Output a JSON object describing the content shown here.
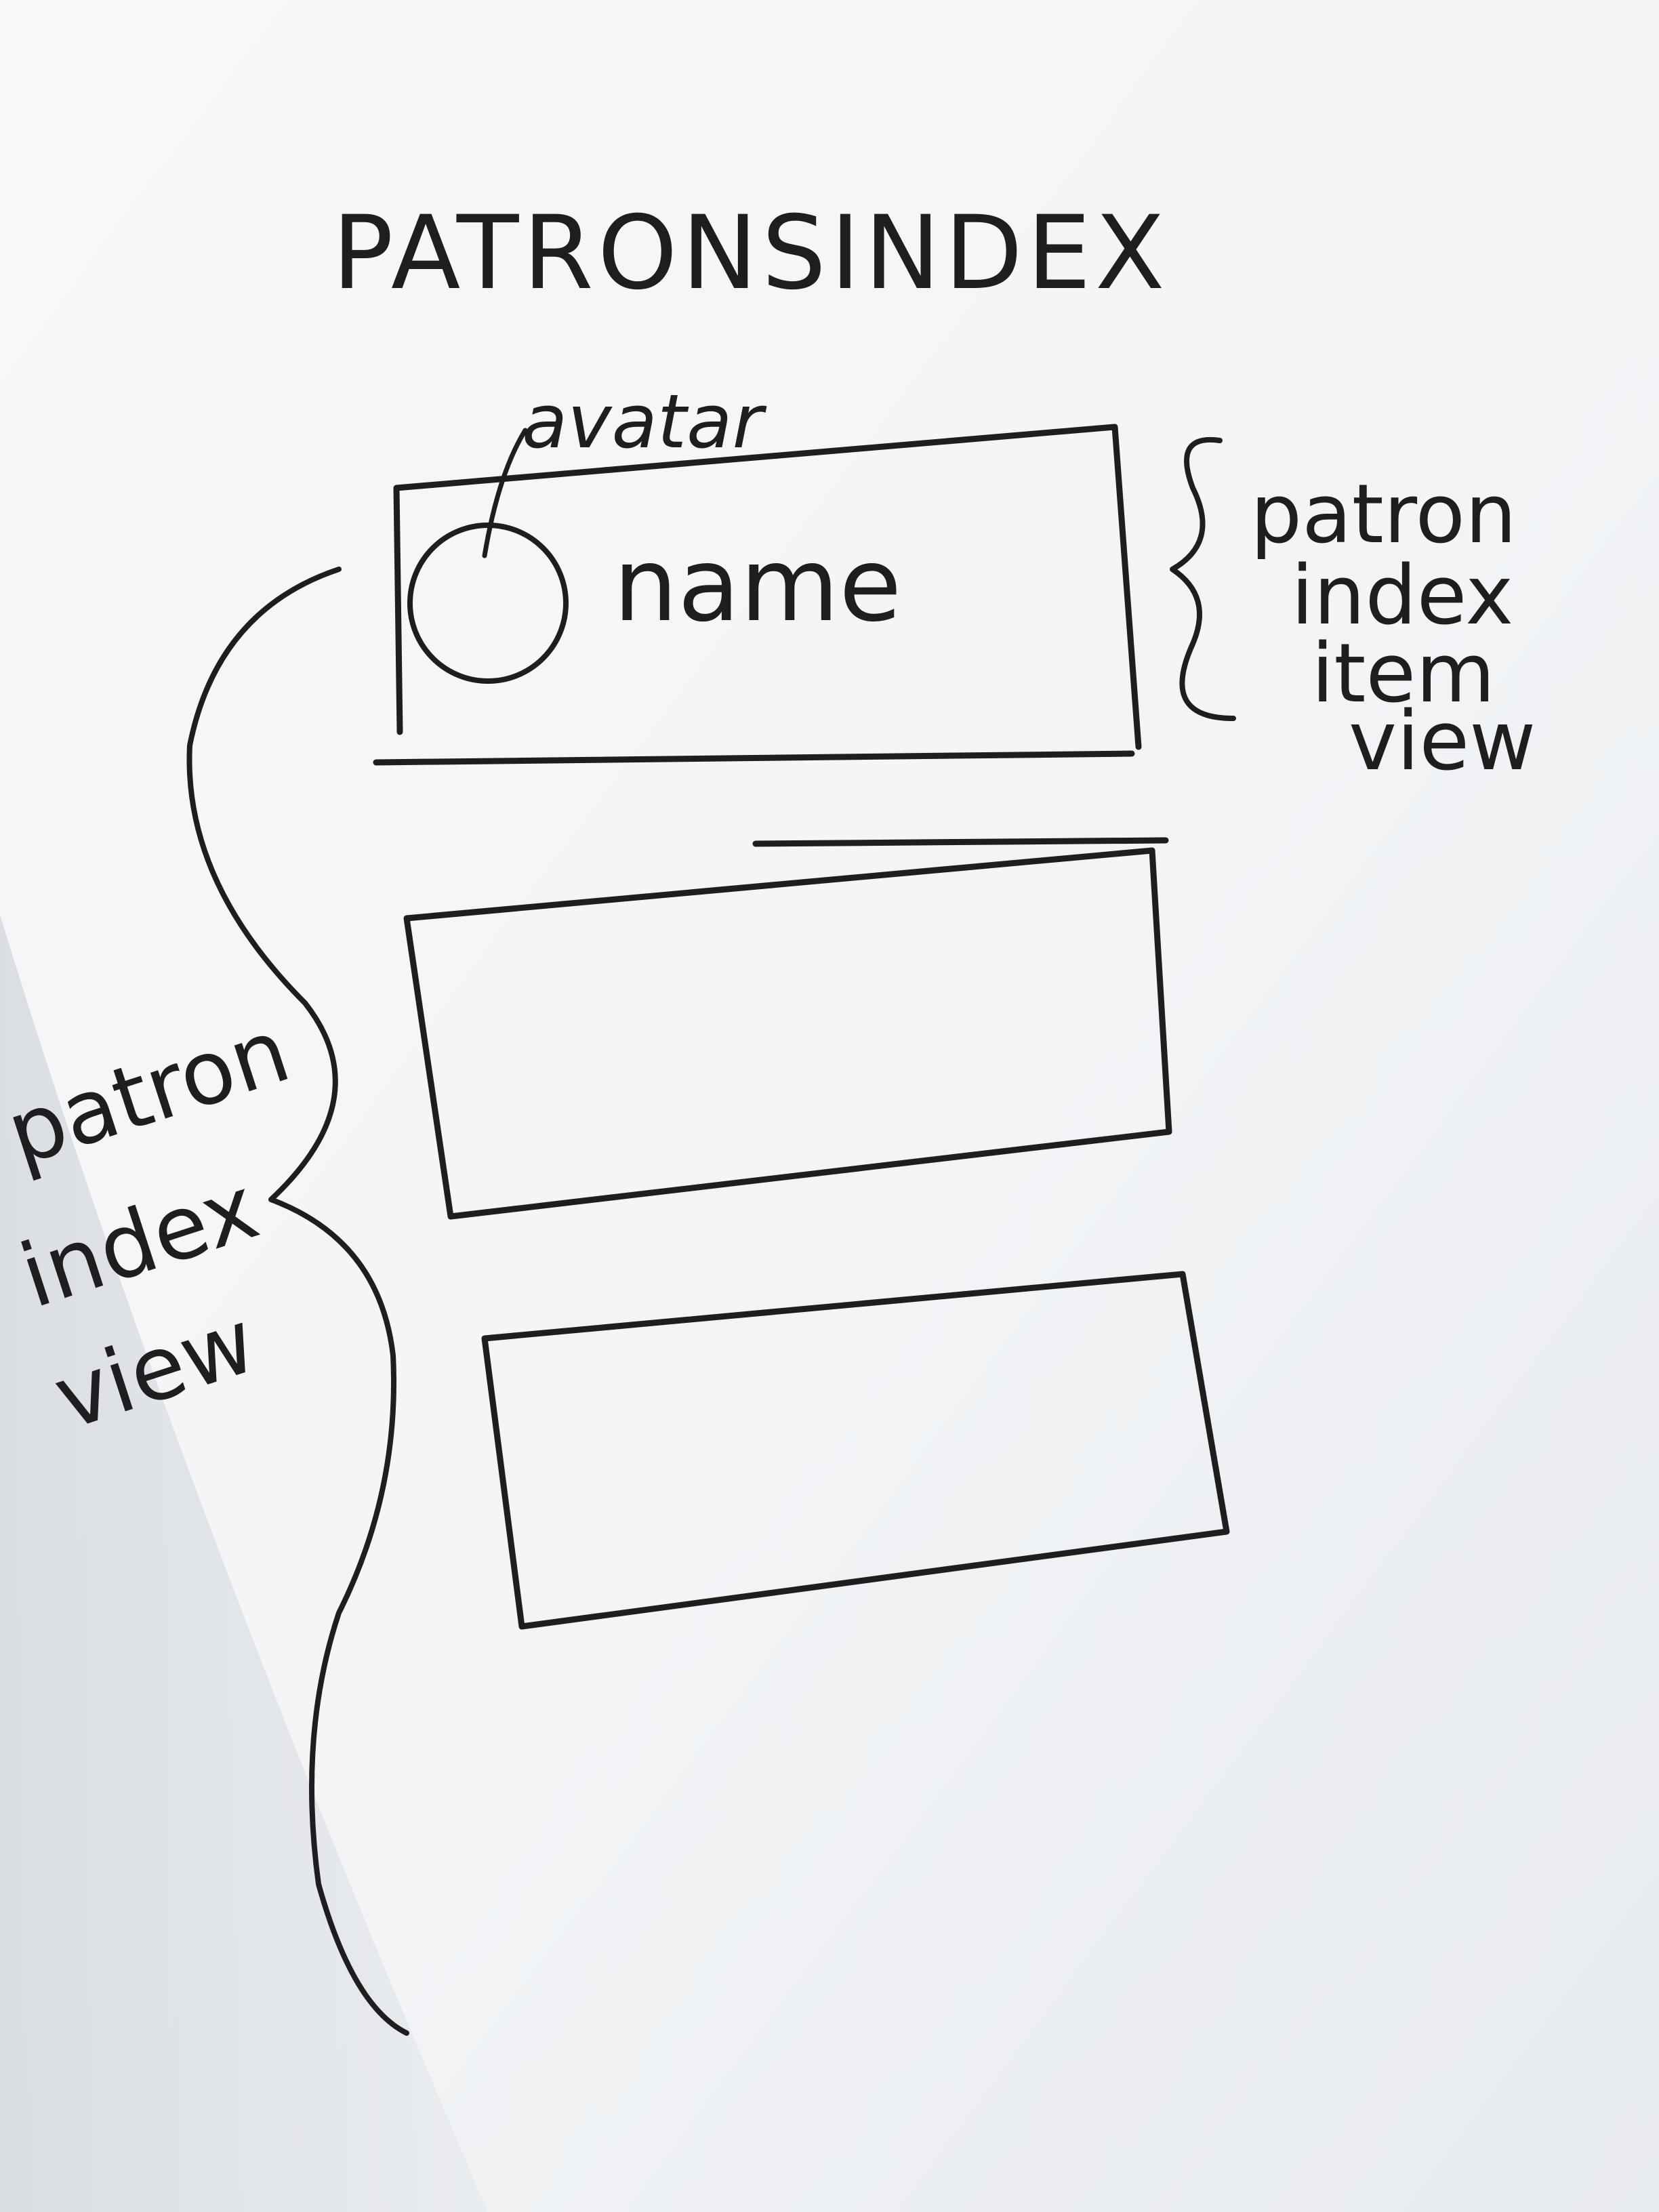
{
  "title": "PATRONSINDEX",
  "callouts": {
    "avatar": "avatar",
    "name": "name",
    "item_view": [
      "patron",
      "index",
      "item",
      "view"
    ],
    "index_view": [
      "patron",
      "index",
      "view"
    ]
  },
  "colors": {
    "paper": "#f4f6f8",
    "paper_shadow": "#dfe3e7",
    "ink": "#1f1d1f"
  }
}
